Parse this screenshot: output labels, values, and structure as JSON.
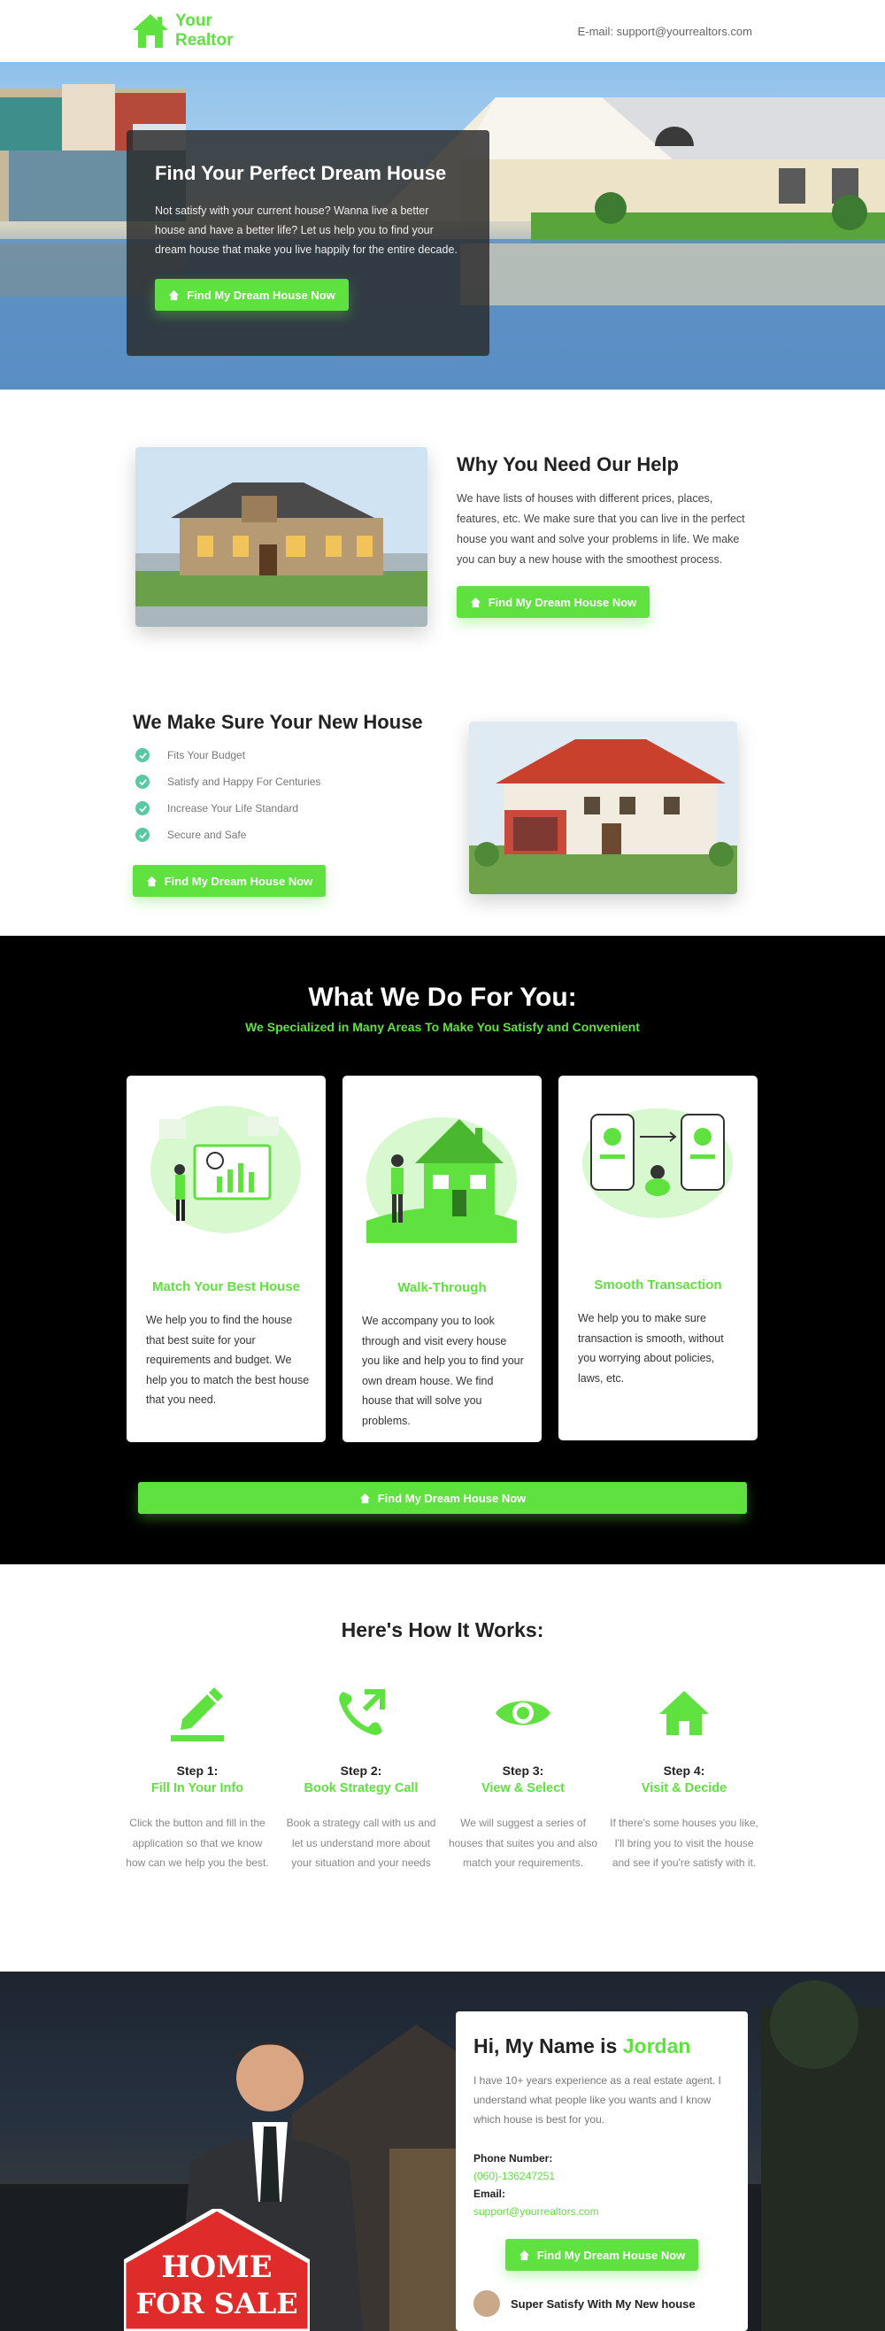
{
  "header": {
    "logo_line1": "Your",
    "logo_line2": "Realtor",
    "email": "E-mail: support@yourrealtors.com"
  },
  "hero": {
    "title": "Find Your Perfect Dream House",
    "text": "Not satisfy with your current house? Wanna live a better house and have a better life? Let us help you to find your dream house that make you live happily for the entire decade.",
    "cta": "Find My Dream House Now"
  },
  "why": {
    "title": "Why You Need Our Help",
    "text": "We have lists of houses with different prices, places, features, etc. We make sure that you can live in the perfect house you want and solve your problems in life. We make you can buy a new house with the smoothest process.",
    "cta": "Find My Dream House Now"
  },
  "make_sure": {
    "title": "We Make Sure Your New House",
    "items": [
      "Fits Your Budget",
      "Satisfy and Happy For Centuries",
      "Increase Your Life Standard",
      "Secure and Safe"
    ],
    "cta": "Find My Dream House Now"
  },
  "services": {
    "title": "What We Do For You:",
    "subtitle": "We Specialized in Many Areas To Make You Satisfy and Convenient",
    "cards": [
      {
        "title": "Match Your Best House",
        "text": "We help you to find the house that best suite for your requirements and budget. We help you to match the best house that you need."
      },
      {
        "title": "Walk-Through",
        "text": "We accompany you to look through and visit every house you like and help you to find your own dream house. We find house that will solve you problems."
      },
      {
        "title": "Smooth Transaction",
        "text": "We help you to make sure transaction is smooth, without you worrying about policies, laws, etc."
      }
    ],
    "cta": "Find My Dream House Now"
  },
  "how": {
    "title": "Here's How It Works:",
    "steps": [
      {
        "num": "Step 1:",
        "name": "Fill In Your Info",
        "icon": "pencil-icon",
        "text": "Click the button and fill in the application so that we know how can we help you the best."
      },
      {
        "num": "Step 2:",
        "name": "Book Strategy Call",
        "icon": "phone-icon",
        "text": "Book a strategy call with us and let us understand more about your situation and your needs"
      },
      {
        "num": "Step 3:",
        "name": "View & Select",
        "icon": "eye-icon",
        "text": "We will suggest a series of houses that suites you and also match your requirements."
      },
      {
        "num": "Step 4:",
        "name": "Visit & Decide",
        "icon": "home-icon",
        "text": "If there's some houses you like, I'll bring you to visit the house and see if you're satisfy with it."
      }
    ]
  },
  "agent": {
    "title_prefix": "Hi, My Name is",
    "name": "Jordan",
    "text": "I have 10+ years experience as a real estate agent. I understand what people like you wants and I know which house is best for you.",
    "phone_label": "Phone Number:",
    "phone": "(060)-136247251",
    "email_label": "Email:",
    "email": "support@yourrealtors.com",
    "cta": "Find My Dream House Now",
    "testimonial": "Super Satisfy With My New house",
    "sign_line1": "HOME",
    "sign_line2": "FOR SALE"
  },
  "colors": {
    "accent": "#5fe13f",
    "dark": "#000000"
  }
}
